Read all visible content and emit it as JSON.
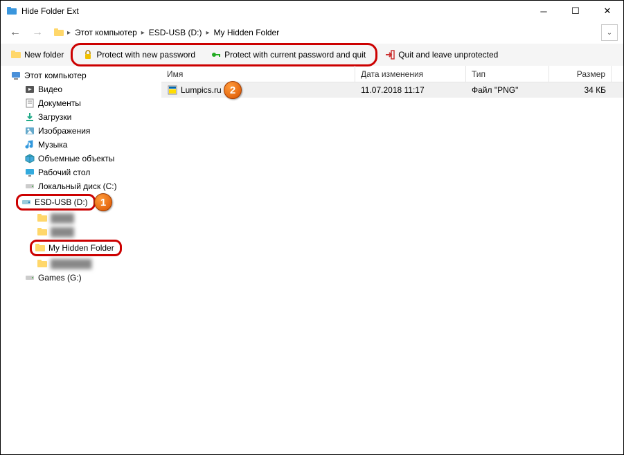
{
  "window": {
    "title": "Hide Folder Ext"
  },
  "breadcrumb": {
    "root": "Этот компьютер",
    "drive": "ESD-USB (D:)",
    "folder": "My Hidden Folder"
  },
  "toolbar": {
    "new_folder": "New folder",
    "protect_new": "Protect with new password",
    "protect_current": "Protect with current password and quit",
    "quit_unprotected": "Quit and leave unprotected"
  },
  "tree": {
    "computer": "Этот компьютер",
    "video": "Видео",
    "documents": "Документы",
    "downloads": "Загрузки",
    "pictures": "Изображения",
    "music": "Музыка",
    "objects3d": "Объемные объекты",
    "desktop": "Рабочий стол",
    "localdisk": "Локальный диск (C:)",
    "esdusb": "ESD-USB (D:)",
    "hiddenfolder": "My Hidden Folder",
    "games": "Games (G:)"
  },
  "columns": {
    "name": "Имя",
    "date": "Дата изменения",
    "type": "Тип",
    "size": "Размер"
  },
  "files": [
    {
      "name": "Lumpics.ru",
      "date": "11.07.2018 11:17",
      "type": "Файл \"PNG\"",
      "size": "34 КБ"
    }
  ],
  "badges": {
    "one": "1",
    "two": "2"
  }
}
